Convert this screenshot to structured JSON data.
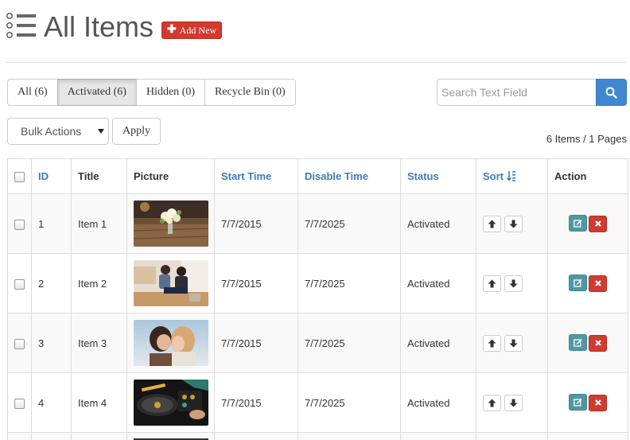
{
  "header": {
    "title": "All Items",
    "add_new_label": "Add New"
  },
  "filters": [
    {
      "label": "All (6)",
      "active": false
    },
    {
      "label": "Activated (6)",
      "active": true
    },
    {
      "label": "Hidden (0)",
      "active": false
    },
    {
      "label": "Recycle Bin (0)",
      "active": false
    }
  ],
  "search": {
    "placeholder": "Search Text Field",
    "button_icon": "search-icon"
  },
  "bulk": {
    "selected": "Bulk Actions",
    "apply_label": "Apply"
  },
  "page_info": "6 Items / 1 Pages",
  "table": {
    "headers": {
      "id": "ID",
      "title": "Title",
      "picture": "Picture",
      "start_time": "Start Time",
      "disable_time": "Disable Time",
      "status": "Status",
      "sort": "Sort",
      "action": "Action"
    },
    "rows": [
      {
        "id": "1",
        "title": "Item 1",
        "start": "7/7/2015",
        "disable": "7/7/2025",
        "status": "Activated"
      },
      {
        "id": "2",
        "title": "Item 2",
        "start": "7/7/2015",
        "disable": "7/7/2025",
        "status": "Activated"
      },
      {
        "id": "3",
        "title": "Item 3",
        "start": "7/7/2015",
        "disable": "7/7/2025",
        "status": "Activated"
      },
      {
        "id": "4",
        "title": "Item 4",
        "start": "7/7/2015",
        "disable": "7/7/2025",
        "status": "Activated"
      }
    ]
  },
  "colors": {
    "link": "#3e7bbb",
    "add_button": "#d23a2e",
    "search_button": "#3f88d0",
    "edit_button": "#4f97a3",
    "delete_button": "#d13b30"
  }
}
